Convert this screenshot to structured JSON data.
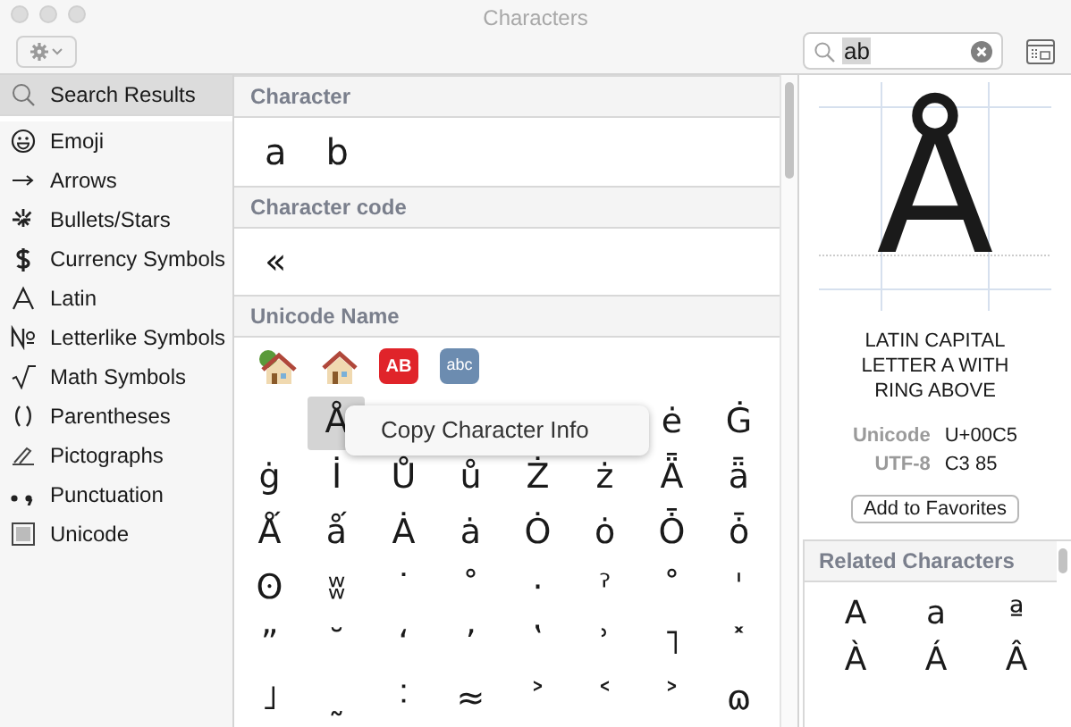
{
  "window": {
    "title": "Characters"
  },
  "search": {
    "value": "ab"
  },
  "sidebar": {
    "items": [
      {
        "label": "Search Results",
        "selected": true,
        "kind": "search"
      },
      {
        "label": "Emoji",
        "selected": false,
        "kind": "emoji"
      },
      {
        "label": "Arrows",
        "selected": false,
        "kind": "arrow"
      },
      {
        "label": "Bullets/Stars",
        "selected": false,
        "kind": "star"
      },
      {
        "label": "Currency Symbols",
        "selected": false,
        "kind": "dollar"
      },
      {
        "label": "Latin",
        "selected": false,
        "kind": "latin"
      },
      {
        "label": "Letterlike Symbols",
        "selected": false,
        "kind": "numero"
      },
      {
        "label": "Math Symbols",
        "selected": false,
        "kind": "root"
      },
      {
        "label": "Parentheses",
        "selected": false,
        "kind": "paren"
      },
      {
        "label": "Pictographs",
        "selected": false,
        "kind": "pen"
      },
      {
        "label": "Punctuation",
        "selected": false,
        "kind": "punct"
      },
      {
        "label": "Unicode",
        "selected": false,
        "kind": "grid"
      }
    ]
  },
  "sections": [
    {
      "title": "Character",
      "chars": [
        "a",
        "b"
      ]
    },
    {
      "title": "Character code",
      "chars": [
        "«"
      ]
    },
    {
      "title": "Unicode Name",
      "symbols": [
        {
          "kind": "house-tree"
        },
        {
          "kind": "house"
        },
        {
          "kind": "badge-red",
          "text": "AB"
        },
        {
          "kind": "badge-blue",
          "text": "abc"
        }
      ],
      "rows": [
        [
          {
            "kind": "blank"
          },
          {
            "kind": "char",
            "char": "Å",
            "selected": true
          },
          {
            "kind": "blank"
          },
          {
            "kind": "blank"
          },
          {
            "kind": "blank"
          },
          {
            "kind": "blank"
          },
          {
            "kind": "char",
            "char": "ė",
            "selected": false
          },
          {
            "kind": "char",
            "char": "Ġ",
            "selected": false
          }
        ],
        [
          {
            "char": "ġ",
            "selected": false
          },
          {
            "char": "İ",
            "selected": false
          },
          {
            "char": "Ů",
            "selected": false
          },
          {
            "char": "ů",
            "selected": false
          },
          {
            "char": "Ż",
            "selected": false
          },
          {
            "char": "ż",
            "selected": false
          },
          {
            "char": "Ǟ",
            "selected": false
          },
          {
            "char": "ǟ",
            "selected": false
          }
        ],
        [
          {
            "char": "Ǻ",
            "selected": false
          },
          {
            "char": "ǻ",
            "selected": false
          },
          {
            "char": "Ȧ",
            "selected": false
          },
          {
            "char": "ȧ",
            "selected": false
          },
          {
            "char": "Ȯ",
            "selected": false
          },
          {
            "char": "ȯ",
            "selected": false
          },
          {
            "char": "Ȱ",
            "selected": false
          },
          {
            "char": "ȱ",
            "selected": false
          }
        ],
        [
          {
            "char": "ʘ",
            "selected": false
          },
          {
            "char": "ʬ",
            "selected": false
          },
          {
            "char": "˙",
            "selected": false
          },
          {
            "char": "˚",
            "selected": false
          },
          {
            "char": "·",
            "selected": false
          },
          {
            "char": "ˀ",
            "selected": false
          },
          {
            "char": "˚",
            "selected": false
          },
          {
            "char": "ˈ",
            "selected": false
          }
        ],
        [
          {
            "char": "ˮ",
            "selected": false
          },
          {
            "char": "˘",
            "selected": false
          },
          {
            "char": "ʻ",
            "selected": false
          },
          {
            "char": "ʼ",
            "selected": false
          },
          {
            "char": "ʽ",
            "selected": false
          },
          {
            "char": "ʾ",
            "selected": false
          },
          {
            "char": "˥",
            "selected": false
          },
          {
            "char": "˟",
            "selected": false
          }
        ],
        [
          {
            "char": "˩",
            "selected": false
          },
          {
            "char": "˷",
            "selected": false
          },
          {
            "char": "˸",
            "selected": false
          },
          {
            "char": "≈",
            "selected": false
          },
          {
            "char": "˃",
            "selected": false
          },
          {
            "char": "˂",
            "selected": false
          },
          {
            "char": "˃",
            "selected": false
          },
          {
            "char": "ɷ",
            "selected": false
          }
        ]
      ]
    }
  ],
  "context_menu": {
    "items": [
      "Copy Character Info"
    ]
  },
  "detail": {
    "glyph": "Å",
    "name": "LATIN CAPITAL LETTER A WITH RING ABOVE",
    "fields": [
      {
        "label": "Unicode",
        "value": "U+00C5"
      },
      {
        "label": "UTF-8",
        "value": "C3 85"
      }
    ],
    "button": "Add to Favorites"
  },
  "related": {
    "title": "Related Characters",
    "chars": [
      "A",
      "a",
      "ª",
      "À",
      "Á",
      "Â"
    ]
  }
}
